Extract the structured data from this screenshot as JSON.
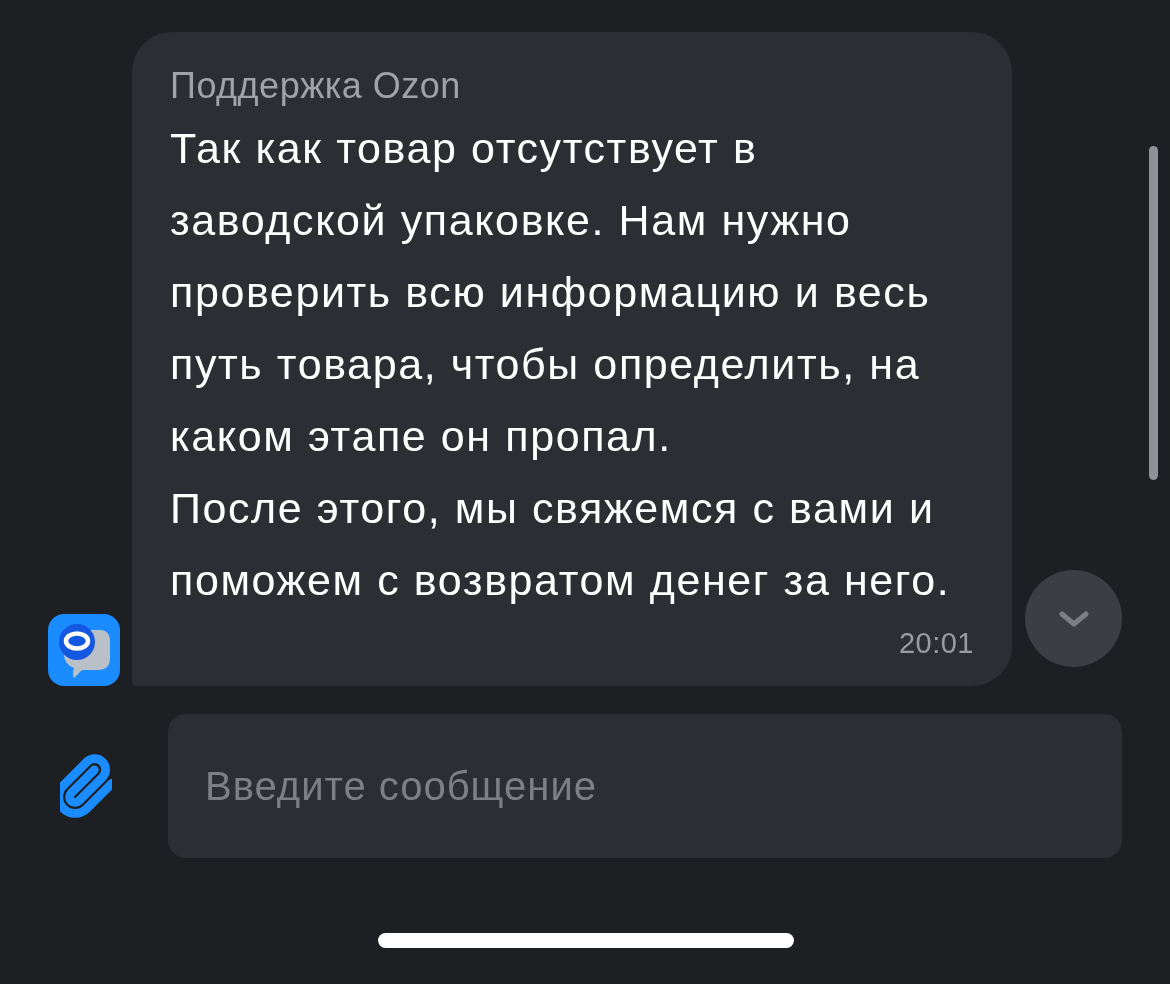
{
  "messages": [
    {
      "sender": "Поддержка Ozon",
      "text": "Так как товар отсутствует в\nзаводской упаковке. Нам нужно\nпроверить всю информацию и весь\nпуть товара, чтобы определить, на\nкаком этапе он пропал.\nПосле этого, мы свяжемся с вами и\nпоможем с возвратом денег за него.",
      "time": "20:01"
    }
  ],
  "composer": {
    "placeholder": "Введите сообщение"
  }
}
